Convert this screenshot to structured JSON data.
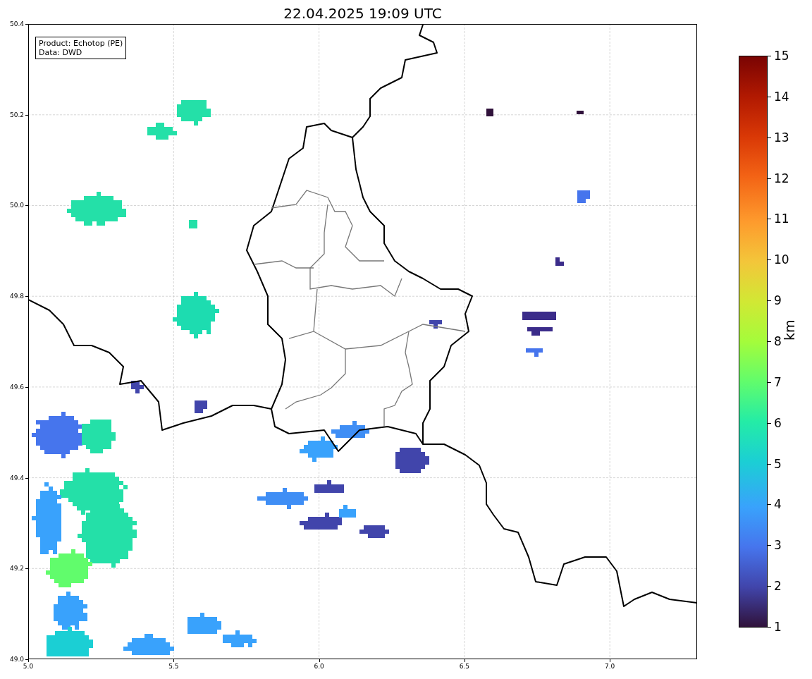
{
  "title": "22.04.2025 19:09 UTC",
  "legend": [
    "Product: Echotop (PE)",
    "Data: DWD"
  ],
  "x_ticks": [
    "5.0",
    "5.5",
    "6.0",
    "6.5",
    "7.0"
  ],
  "y_ticks": [
    "50.4",
    "50.2",
    "50.0",
    "49.8",
    "49.6",
    "49.4",
    "49.2",
    "49.0"
  ],
  "colorbar": {
    "label": "km",
    "ticks": [
      "15",
      "14",
      "13",
      "12",
      "11",
      "10",
      "9",
      "8",
      "7",
      "6",
      "5",
      "4",
      "3",
      "2",
      "1"
    ]
  }
}
